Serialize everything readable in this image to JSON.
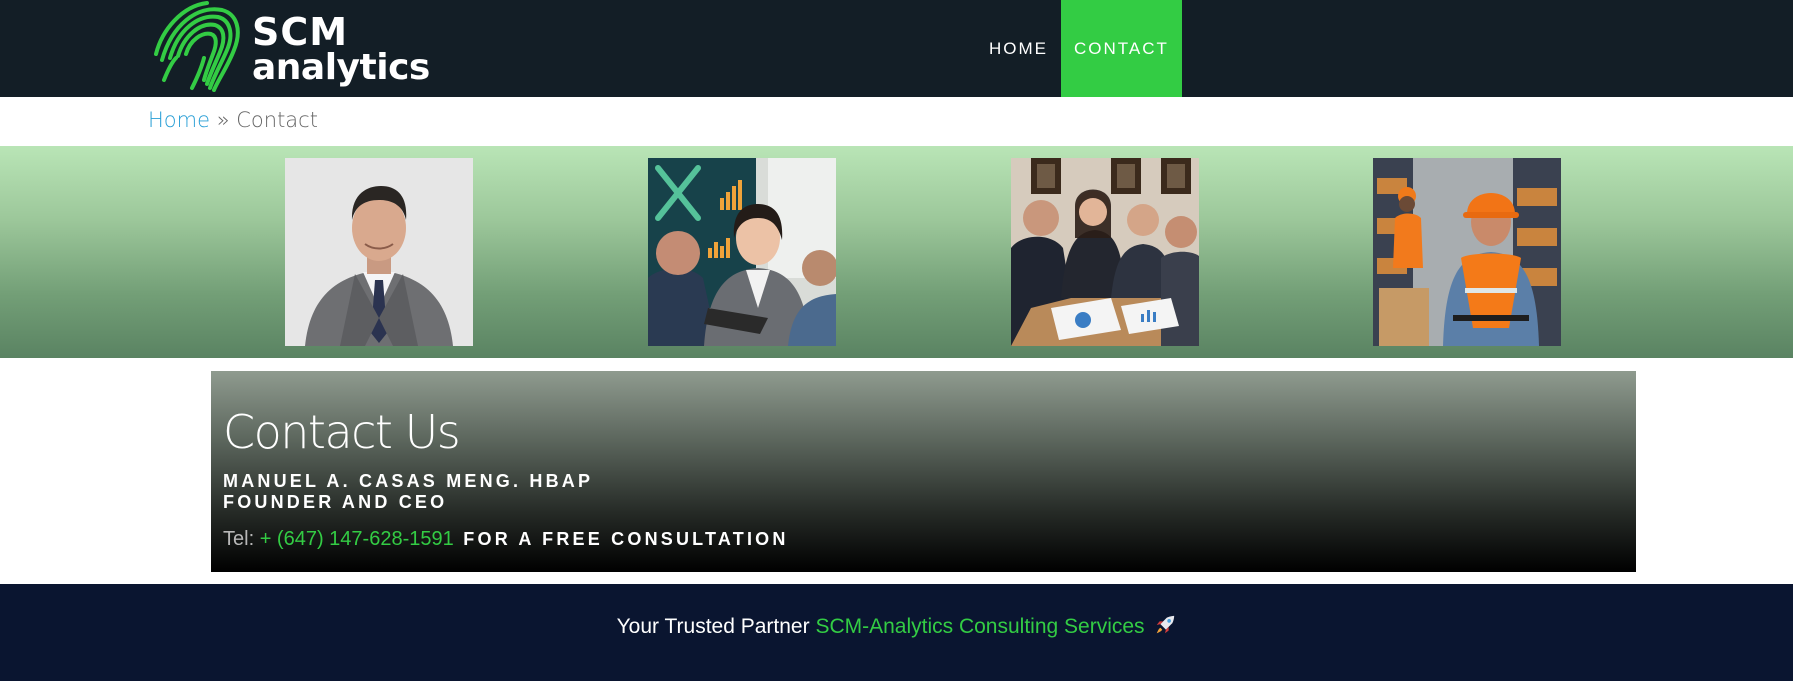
{
  "header": {
    "logo": {
      "line1": "SCM",
      "line2": "analytics",
      "icon": "fingerprint-swirl-icon"
    },
    "nav": [
      {
        "label": "HOME",
        "active": false
      },
      {
        "label": "CONTACT",
        "active": true
      }
    ]
  },
  "breadcrumb": {
    "home": "Home",
    "separator": "»",
    "current": "Contact"
  },
  "gallery": {
    "images": [
      {
        "name": "portrait of business man"
      },
      {
        "name": "team meeting with headsets and dashboard"
      },
      {
        "name": "consultants reviewing charts at table"
      },
      {
        "name": "warehouse workers with safety vests"
      }
    ]
  },
  "contact": {
    "title": "Contact Us",
    "name": "MANUEL A. CASAS MENG. HBAP",
    "role": "FOUNDER AND CEO",
    "tel_label": "Tel:",
    "tel_number": "+ (647) 147-628-1591",
    "cta": "FOR A FREE CONSULTATION"
  },
  "footer": {
    "prefix": "Your Trusted Partner",
    "brand": "SCM-Analytics Consulting Services",
    "icon": "rocket-icon"
  },
  "colors": {
    "header_bg": "#131e26",
    "accent": "#33cc44",
    "link": "#2a9fd6",
    "footer_bg": "#0a1530"
  }
}
